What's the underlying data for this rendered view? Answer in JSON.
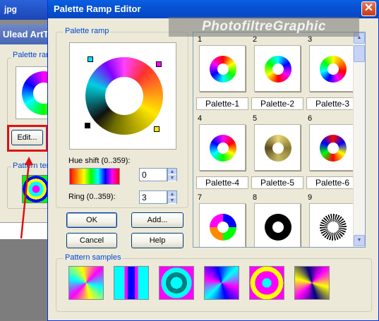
{
  "background_window": {
    "title_fragment": "jpg",
    "app_title": "Ulead ArtT",
    "palette_ramp_label": "Palette ram",
    "edit_button": "Edit...",
    "pattern_label": "Pattern term"
  },
  "dialog": {
    "title": "Palette Ramp Editor",
    "close_glyph": "✕",
    "watermark": "PhotofiltreGraphic",
    "palette_ramp_group": "Palette ramp",
    "hue_shift_label": "Hue shift (0..359):",
    "hue_shift_value": "0",
    "ring_label": "Ring (0..359):",
    "ring_value": "3",
    "buttons": {
      "ok": "OK",
      "add": "Add...",
      "cancel": "Cancel",
      "help": "Help"
    },
    "palettes": [
      {
        "num": "1",
        "name": "Palette-1"
      },
      {
        "num": "2",
        "name": "Palette-2"
      },
      {
        "num": "3",
        "name": "Palette-3"
      },
      {
        "num": "4",
        "name": "Palette-4"
      },
      {
        "num": "5",
        "name": "Palette-5"
      },
      {
        "num": "6",
        "name": "Palette-6"
      },
      {
        "num": "7",
        "name": ""
      },
      {
        "num": "8",
        "name": ""
      },
      {
        "num": "9",
        "name": ""
      }
    ],
    "pattern_samples_label": "Pattern samples",
    "scroll_up_glyph": "▲",
    "scroll_down_glyph": "▼",
    "spin_up_glyph": "▲",
    "spin_down_glyph": "▼"
  },
  "colors": {
    "title_bar": "#0553d4",
    "highlight_red": "#e01010",
    "group_label": "#0046d5"
  }
}
